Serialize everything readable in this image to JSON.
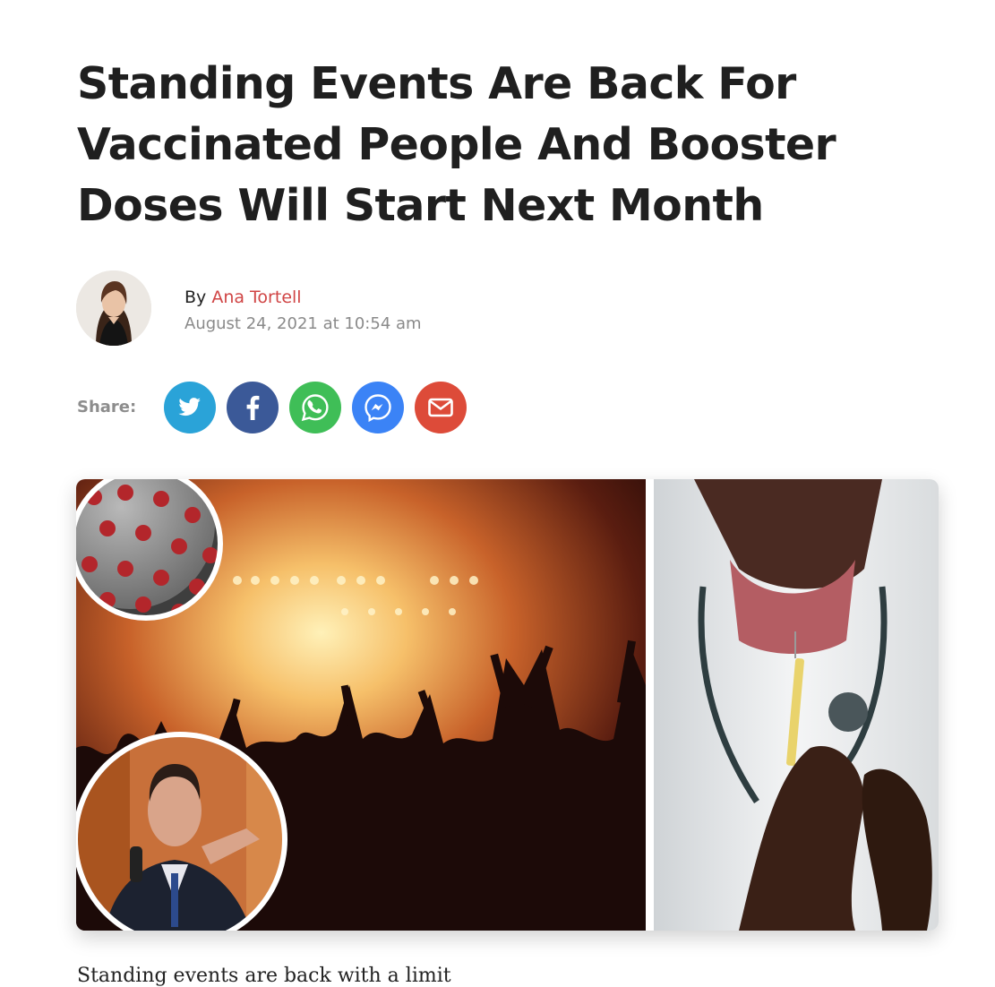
{
  "article": {
    "headline": "Standing Events Are Back For Vaccinated People And Booster Doses Will Start Next Month",
    "byline_prefix": "By",
    "author_name": "Ana Tortell",
    "published": "August 24, 2021 at 10:54 am",
    "intro_text": "Standing events are back with a limit"
  },
  "share": {
    "label": "Share:",
    "buttons": [
      {
        "name": "twitter",
        "icon": "twitter-bird-icon",
        "color": "#2aa3d8"
      },
      {
        "name": "facebook",
        "icon": "facebook-f-icon",
        "color": "#3b5998"
      },
      {
        "name": "whatsapp",
        "icon": "whatsapp-phone-icon",
        "color": "#3fbe57"
      },
      {
        "name": "messenger",
        "icon": "messenger-bolt-icon",
        "color": "#3b83f6"
      },
      {
        "name": "email",
        "icon": "envelope-icon",
        "color": "#dd4b39"
      }
    ]
  },
  "colors": {
    "author_link": "#d04545",
    "meta_gray": "#8a8a8a",
    "text": "#1f1f1f"
  }
}
